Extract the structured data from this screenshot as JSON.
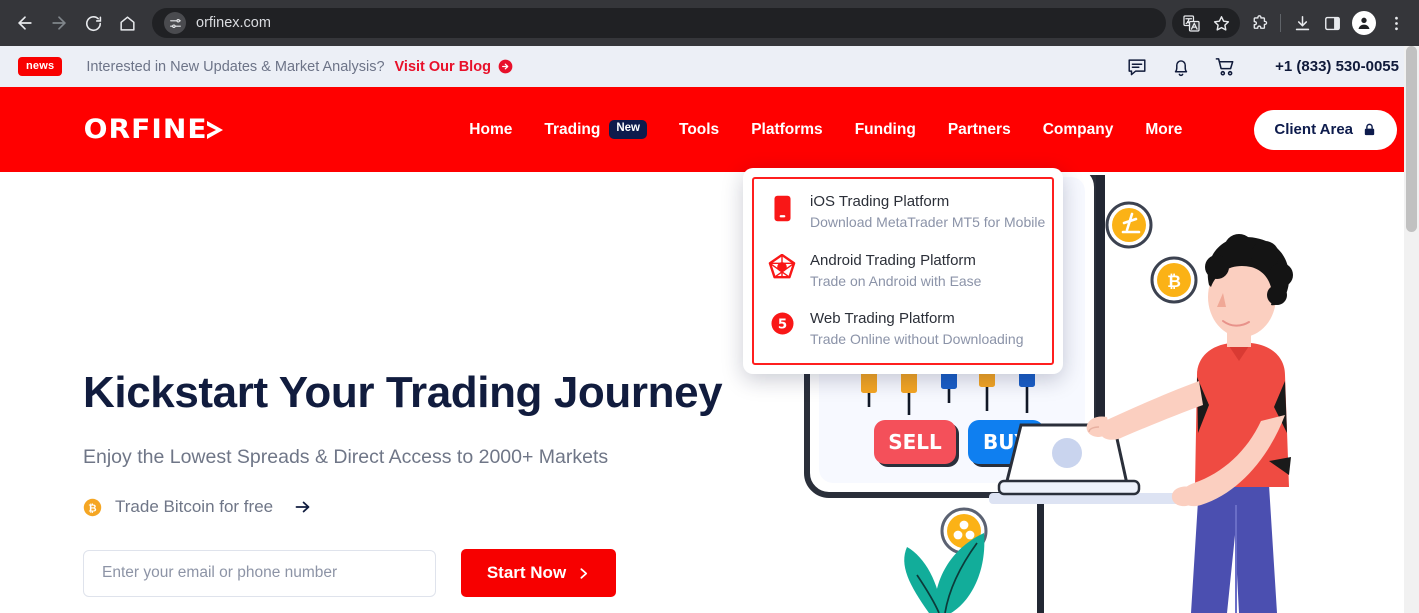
{
  "browser": {
    "url": "orfinex.com",
    "icons": {
      "back": "back-arrow-icon",
      "forward": "forward-arrow-icon",
      "reload": "reload-icon",
      "home": "home-icon",
      "site_settings": "site-settings-icon",
      "translate": "translate-icon",
      "bookmark": "star-icon",
      "extensions": "extensions-puzzle-icon",
      "downloads": "download-icon",
      "side_panel": "side-panel-icon",
      "profile": "profile-avatar-icon",
      "menu": "three-dot-menu-icon"
    }
  },
  "topbar": {
    "badge": "news",
    "message": "Interested in New Updates & Market Analysis?",
    "link_label": "Visit Our Blog",
    "phone": "+1 (833) 530-0055",
    "icons": {
      "chat": "chat-icon",
      "bell": "notification-bell-icon",
      "cart": "shopping-cart-icon",
      "link_arrow": "arrow-circle-right-icon"
    }
  },
  "header": {
    "logo": "ORFINE",
    "nav": [
      {
        "label": "Home",
        "badge": null
      },
      {
        "label": "Trading",
        "badge": "New"
      },
      {
        "label": "Tools",
        "badge": null
      },
      {
        "label": "Platforms",
        "badge": null
      },
      {
        "label": "Funding",
        "badge": null
      },
      {
        "label": "Partners",
        "badge": null
      },
      {
        "label": "Company",
        "badge": null
      },
      {
        "label": "More",
        "badge": null
      }
    ],
    "client_area": "Client Area",
    "client_area_icon": "lock-icon",
    "background_color": "#ff0000"
  },
  "dropdown": {
    "items": [
      {
        "title": "iOS Trading Platform",
        "subtitle": "Download MetaTrader MT5 for Mobile",
        "icon": "ios-mobile-icon"
      },
      {
        "title": "Android Trading Platform",
        "subtitle": "Trade on Android with Ease",
        "icon": "android-icon"
      },
      {
        "title": "Web Trading Platform",
        "subtitle": "Trade Online without Downloading",
        "icon": "mt5-number-five-icon"
      }
    ],
    "border_color": "#ff1f1f"
  },
  "hero": {
    "title": "Kickstart Your Trading Journey",
    "subtitle": "Enjoy the Lowest Spreads & Direct Access to 2000+ Markets",
    "bitcoin_link": "Trade Bitcoin for free",
    "bitcoin_icon": "bitcoin-coin-icon",
    "arrow_icon": "arrow-right-icon",
    "email_placeholder": "Enter your email or phone number",
    "email_value": "",
    "cta_label": "Start Now",
    "cta_icon": "chevron-right-icon"
  },
  "illustration": {
    "sell_label": "SELL",
    "buy_label": "BUY",
    "coins": [
      "litecoin-coin-icon",
      "bitcoin-coin-icon",
      "ripple-coin-icon"
    ],
    "colors": {
      "sell": "#f4505a",
      "buy": "#0f7ff0",
      "shirt": "#ef4b42",
      "pants": "#4b4fb0",
      "coin": "#fbb216",
      "leaf": "#12ad9a"
    }
  },
  "theme": {
    "brand_red": "#ff0000",
    "accent_navy": "#0d1b4c",
    "muted_text": "#6f7687"
  }
}
